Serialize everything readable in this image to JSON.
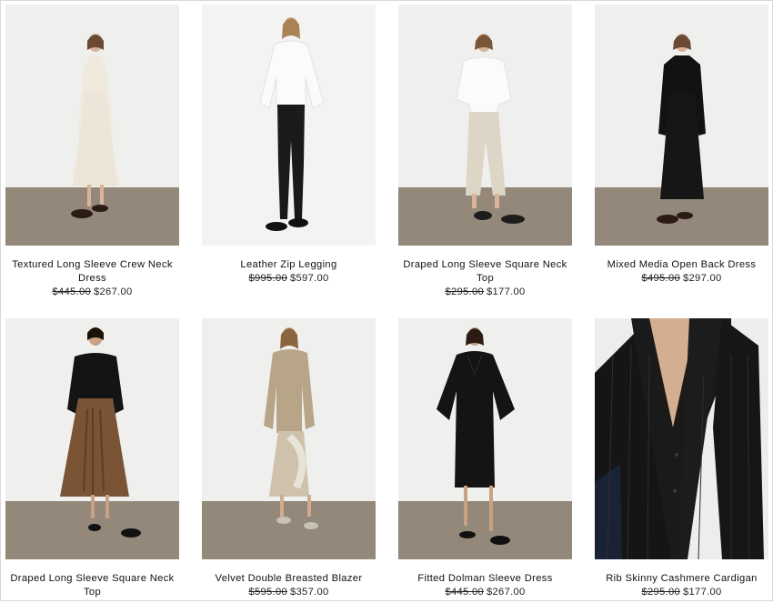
{
  "products": [
    {
      "name": "Textured Long Sleeve Crew Neck Dress",
      "original_price": "$445.00",
      "sale_price": "$267.00",
      "image": "model-cream-dress"
    },
    {
      "name": "Leather Zip Legging",
      "original_price": "$995.00",
      "sale_price": "$597.00",
      "image": "model-white-shirt-black-legging"
    },
    {
      "name": "Draped Long Sleeve Square Neck Top",
      "original_price": "$295.00",
      "sale_price": "$177.00",
      "image": "model-white-top-beige-pants"
    },
    {
      "name": "Mixed Media Open Back Dress",
      "original_price": "$495.00",
      "sale_price": "$297.00",
      "image": "model-black-dress"
    },
    {
      "name": "Draped Long Sleeve Square Neck Top",
      "original_price": "",
      "sale_price": "",
      "image": "model-black-top-brown-skirt"
    },
    {
      "name": "Velvet Double Breasted Blazer",
      "original_price": "$595.00",
      "sale_price": "$357.00",
      "image": "model-beige-blazer"
    },
    {
      "name": "Fitted Dolman Sleeve Dress",
      "original_price": "$445.00",
      "sale_price": "$267.00",
      "image": "model-black-knit-dress"
    },
    {
      "name": "Rib Skinny Cashmere Cardigan",
      "original_price": "$295.00",
      "sale_price": "$177.00",
      "image": "closeup-black-cardigan"
    }
  ]
}
